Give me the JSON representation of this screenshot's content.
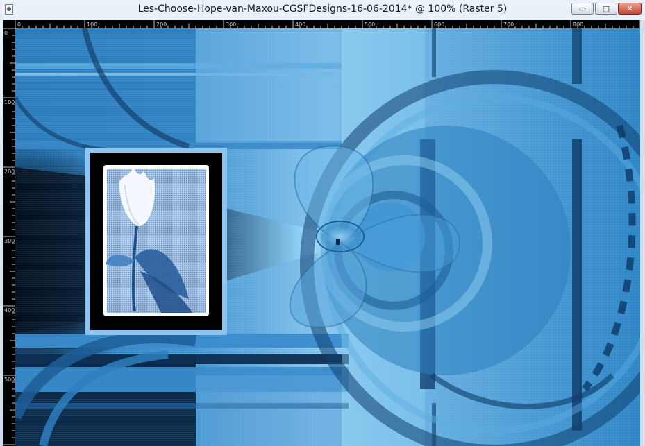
{
  "window": {
    "title": "Les-Choose-Hope-van-Maxou-CGSFDesigns-16-06-2014* @ 100% (Raster 5)",
    "minimize_label": "▭",
    "maximize_label": "□",
    "close_label": "✕"
  },
  "ruler": {
    "horizontal_labels": [
      "0",
      "100",
      "200",
      "300",
      "400",
      "500",
      "600",
      "700",
      "800"
    ],
    "vertical_labels": [
      "0",
      "100",
      "200",
      "300",
      "400",
      "500"
    ]
  },
  "colors": {
    "canvas_blue": "#2f86c6",
    "dark_navy": "#06111f",
    "light_blue": "#8cc7ee",
    "frame_light": "#8fc4ee"
  },
  "icons": {
    "app": "paint-document-icon",
    "frame_image": "tulip-image"
  }
}
